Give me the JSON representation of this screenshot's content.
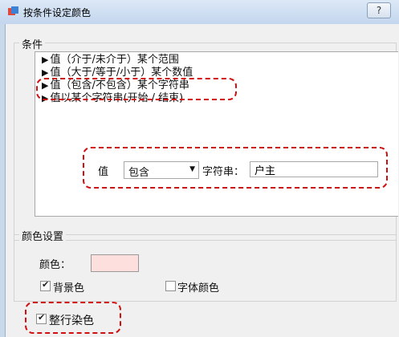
{
  "window": {
    "title": "按条件设定颜色",
    "help_label": "?"
  },
  "conditions": {
    "group_label": "条件",
    "items": [
      {
        "label": "值（介于/未介于）某个范围"
      },
      {
        "label": "值（大于/等于/小于）某个数值"
      },
      {
        "label": "值（包含/不包含）某个字符串"
      },
      {
        "label": "值以某个字符串(开始 / 结束)"
      }
    ],
    "selected_index": 2,
    "value_label": "值",
    "operator_value": "包含",
    "string_label": "字符串：",
    "string_value": "户主"
  },
  "color_settings": {
    "group_label": "颜色设置",
    "color_label": "颜色：",
    "swatch_color": "#fde0dd",
    "background_label": "背景色",
    "background_checked": true,
    "font_color_label": "字体颜色",
    "font_color_checked": false
  },
  "whole_row": {
    "label": "整行染色",
    "checked": true
  },
  "colors": {
    "highlight": "#d01010",
    "titlebar": "#c9d9ec",
    "panel": "#f0f0f0"
  }
}
